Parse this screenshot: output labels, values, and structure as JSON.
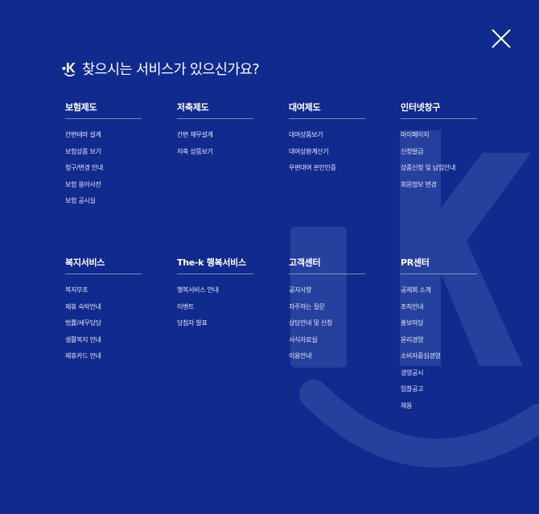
{
  "headline": "찾으시는 서비스가 있으신가요?",
  "icons": {
    "close": "close-icon",
    "logo": "k-logo-icon",
    "watermark": "k-watermark-icon"
  },
  "colors": {
    "background": "#112a8e",
    "text": "#ffffff"
  },
  "menu": [
    {
      "title": "보험제도",
      "items": [
        "간편테마 설계",
        "보험상품 보기",
        "청구/변경 안내",
        "보험 용어사전",
        "보험 공시실"
      ]
    },
    {
      "title": "저축제도",
      "items": [
        "간편 재무설계",
        "저축 상품보기"
      ]
    },
    {
      "title": "대여제도",
      "items": [
        "대여상품보기",
        "대여상환계산기",
        "우편대여 본인인증"
      ]
    },
    {
      "title": "인터넷창구",
      "items": [
        "마이페이지",
        "신청발급",
        "상품신청 및 납입안내",
        "회원정보 변경"
      ]
    },
    {
      "title": "복지서비스",
      "items": [
        "복지부조",
        "제휴 숙박안내",
        "법률/세무담당",
        "생활복지 안내",
        "제휴카드 안내"
      ]
    },
    {
      "title": "The-k 행복서비스",
      "items": [
        "행복서비스 안내",
        "이벤트",
        "당첨자 발표"
      ]
    },
    {
      "title": "고객센터",
      "items": [
        "공지사항",
        "자주하는 질문",
        "상담안내 및 신청",
        "서식자료실",
        "이용안내"
      ]
    },
    {
      "title": "PR센터",
      "items": [
        "공제회 소개",
        "조직안내",
        "홍보마당",
        "윤리경영",
        "소비자중심경영",
        "경영공시",
        "입찰공고",
        "채용"
      ]
    }
  ]
}
